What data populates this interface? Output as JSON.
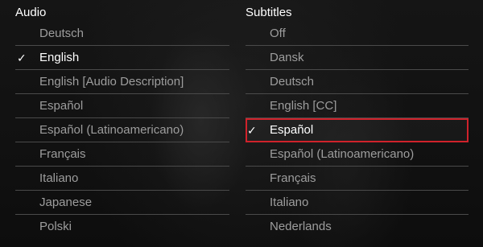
{
  "audio": {
    "header": "Audio",
    "options": [
      {
        "label": "Deutsch",
        "check": ""
      },
      {
        "label": "English",
        "check": "✓"
      },
      {
        "label": "English [Audio Description]",
        "check": ""
      },
      {
        "label": "Español",
        "check": ""
      },
      {
        "label": "Español (Latinoamericano)",
        "check": ""
      },
      {
        "label": "Français",
        "check": ""
      },
      {
        "label": "Italiano",
        "check": ""
      },
      {
        "label": "Japanese",
        "check": ""
      },
      {
        "label": "Polski",
        "check": ""
      }
    ]
  },
  "subtitles": {
    "header": "Subtitles",
    "options": [
      {
        "label": "Off",
        "check": ""
      },
      {
        "label": "Dansk",
        "check": ""
      },
      {
        "label": "Deutsch",
        "check": ""
      },
      {
        "label": "English [CC]",
        "check": ""
      },
      {
        "label": "Español",
        "check": "✓"
      },
      {
        "label": "Español (Latinoamericano)",
        "check": ""
      },
      {
        "label": "Français",
        "check": ""
      },
      {
        "label": "Italiano",
        "check": ""
      },
      {
        "label": "Nederlands",
        "check": ""
      }
    ]
  },
  "colors": {
    "focus_outline": "#d0222b",
    "selected_text": "#ffffff",
    "unselected_text": "#9d9d9d",
    "divider": "#4a4a4a"
  }
}
